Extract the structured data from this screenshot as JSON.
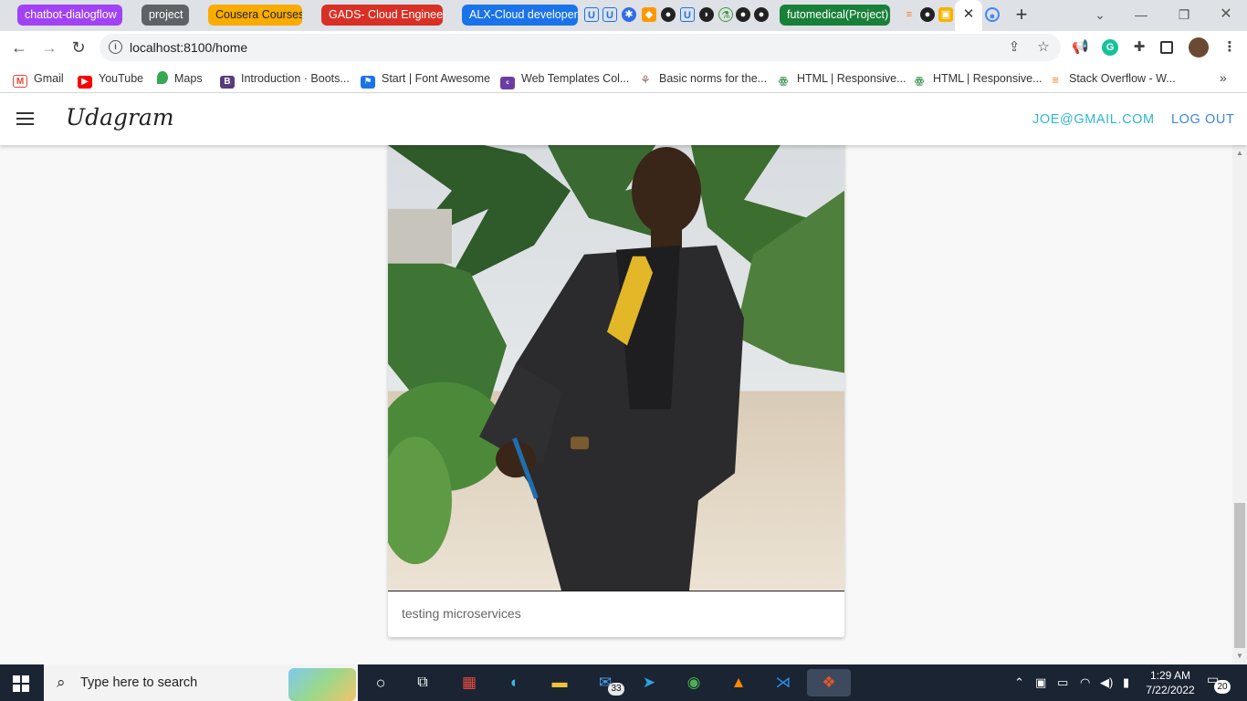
{
  "browser": {
    "tab_groups": [
      {
        "label": "chatbot-dialogflow",
        "color": "#a142f4"
      },
      {
        "label": "project",
        "color": "#5f6368"
      },
      {
        "label": "Cousera Courses",
        "color": "#f9ab00"
      },
      {
        "label": "GADS- Cloud Engineer",
        "color": "#d93025"
      },
      {
        "label": "ALX-Cloud developer",
        "color": "#1a73e8"
      },
      {
        "label": "futomedical(Project)",
        "color": "#188038"
      }
    ],
    "url": "localhost:8100/home"
  },
  "bookmarks": [
    {
      "label": "Gmail",
      "icon": "gmail-icon"
    },
    {
      "label": "YouTube",
      "icon": "youtube-icon"
    },
    {
      "label": "Maps",
      "icon": "maps-icon"
    },
    {
      "label": "Introduction · Boots...",
      "icon": "bootstrap-icon"
    },
    {
      "label": "Start | Font Awesome",
      "icon": "fontawesome-icon"
    },
    {
      "label": "Web Templates Col...",
      "icon": "colorlib-icon"
    },
    {
      "label": "Basic norms for the...",
      "icon": "norms-icon"
    },
    {
      "label": "HTML | Responsive...",
      "icon": "geeksforgeeks-icon"
    },
    {
      "label": "HTML | Responsive...",
      "icon": "geeksforgeeks-icon"
    },
    {
      "label": "Stack Overflow - W...",
      "icon": "stackoverflow-icon"
    }
  ],
  "app": {
    "title": "Udagram",
    "user_email": "JOE@GMAIL.COM",
    "logout_label": "LOG OUT"
  },
  "feed": {
    "items": [
      {
        "caption": "testing microservices",
        "image": "photo of a man in a black suit and yellow tie standing outdoors among trees"
      }
    ]
  },
  "taskbar": {
    "search_placeholder": "Type here to search",
    "mail_badge": "33",
    "time": "1:29 AM",
    "date": "7/22/2022",
    "notification_count": "20"
  },
  "colors": {
    "accent_email": "#2fb5d8",
    "accent_logout": "#3a86dd"
  }
}
